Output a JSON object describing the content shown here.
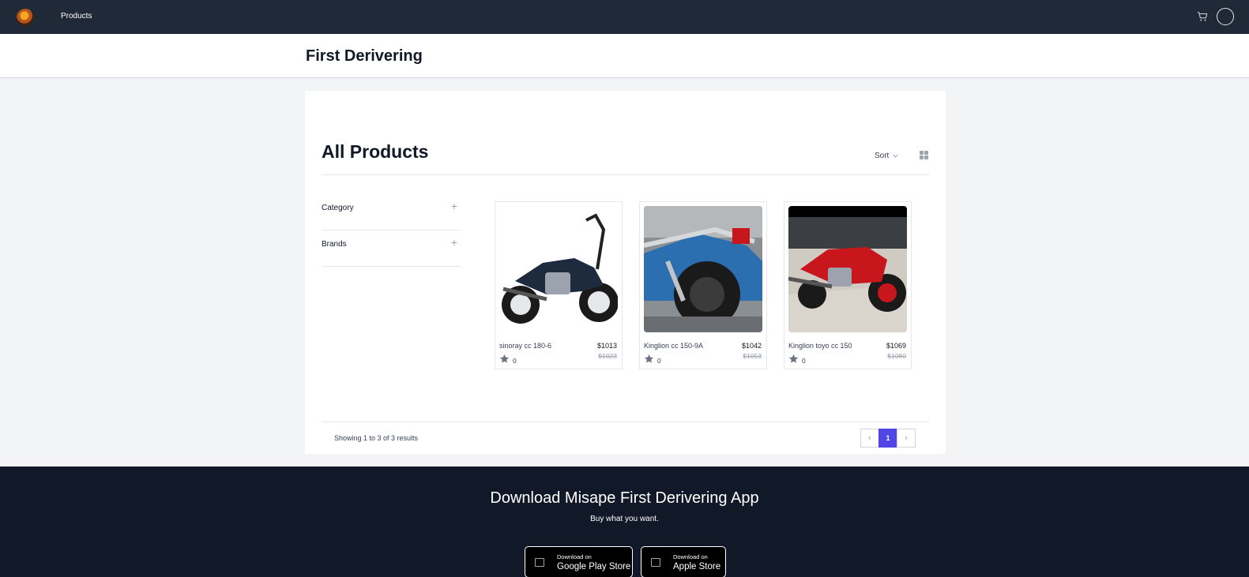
{
  "nav": {
    "products_label": "Products",
    "icons": [
      "logo",
      "cart-icon",
      "avatar"
    ]
  },
  "page": {
    "title": "First Derivering"
  },
  "catalog": {
    "section_title": "All Products",
    "sort_label": "Sort",
    "filters": [
      {
        "label": "Category"
      },
      {
        "label": "Brands"
      }
    ],
    "products": [
      {
        "name": "sinoray cc 180-6",
        "price": "$1013",
        "old_price": "$1023",
        "rating": "0",
        "photo_bg": "#ffffff",
        "bike_color": "#1e2b3f"
      },
      {
        "name": "Kinglion cc 150-9A",
        "price": "$1042",
        "old_price": "$1053",
        "rating": "0",
        "photo_bg": "#8a8f94",
        "bike_color": "#2b6fb0"
      },
      {
        "name": "Kinglion toyo cc 150",
        "price": "$1069",
        "old_price": "$1080",
        "rating": "0",
        "photo_bg": "#cfcac2",
        "bike_color": "#c8161d"
      }
    ],
    "results_text": "Showing 1 to 3 of 3 results",
    "pagination": {
      "prev": "‹",
      "current": "1",
      "next": "›"
    }
  },
  "app_banner": {
    "title": "Download Misape First Derivering App",
    "subtitle": "Buy what you want.",
    "google": {
      "small": "Download on",
      "big": "Google Play Store"
    },
    "apple": {
      "small": "Download on",
      "big": "Apple Store"
    }
  },
  "colors": {
    "nav_bg": "#1f2937",
    "banner_bg": "#111827",
    "accent": "#4f46e5"
  }
}
